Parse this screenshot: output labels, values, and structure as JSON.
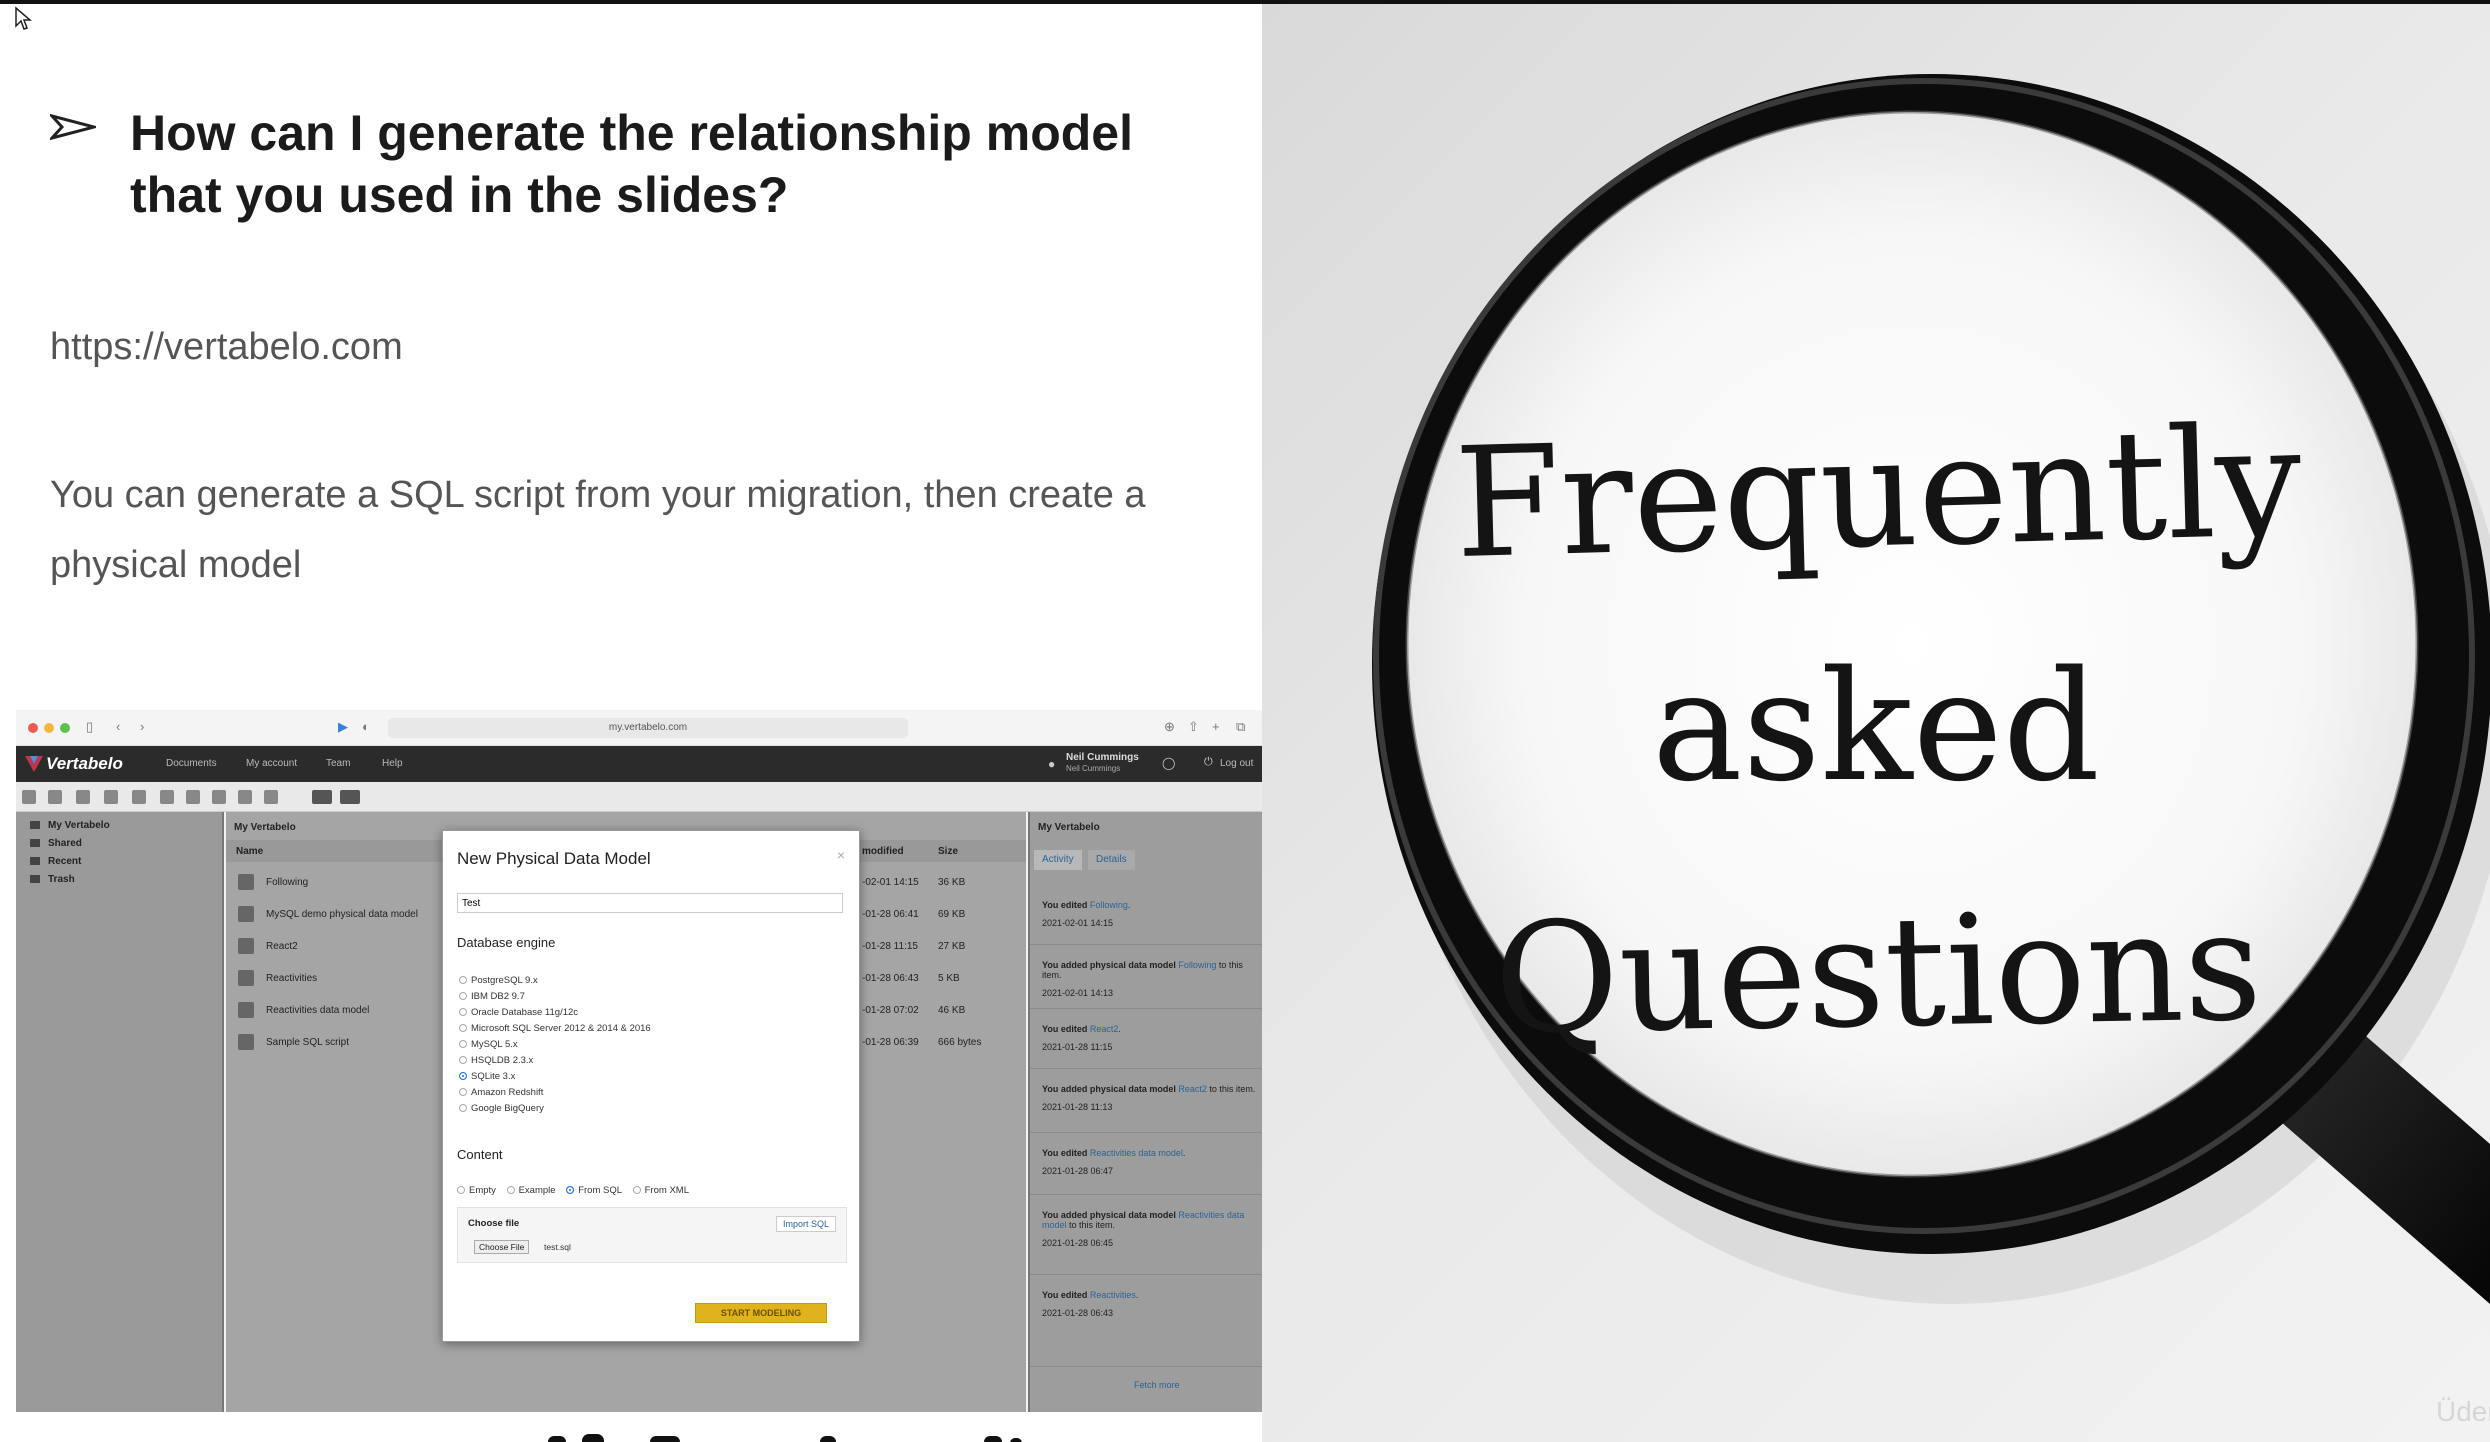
{
  "slide": {
    "question": "How can I generate the relationship model that you used in the slides?",
    "url": "https://vertabelo.com",
    "answer": "You can generate a SQL script from your migration, then create a physical model"
  },
  "screenshot": {
    "address": "my.vertabelo.com",
    "logo": "Vertabelo",
    "nav": [
      "Documents",
      "My account",
      "Team",
      "Help"
    ],
    "user_name": "Neil Cummings",
    "user_sub": "Neil Cummings",
    "logout": "Log out",
    "tree": [
      "My Vertabelo",
      "Shared",
      "Recent",
      "Trash"
    ],
    "files_title": "My Vertabelo",
    "col_name": "Name",
    "col_modified": "modified",
    "col_size": "Size",
    "files": [
      {
        "name": "Following",
        "modified": "-02-01 14:15",
        "size": "36 KB"
      },
      {
        "name": "MySQL demo physical data model",
        "modified": "-01-28 06:41",
        "size": "69 KB"
      },
      {
        "name": "React2",
        "modified": "-01-28 11:15",
        "size": "27 KB"
      },
      {
        "name": "Reactivities",
        "modified": "-01-28 06:43",
        "size": "5 KB"
      },
      {
        "name": "Reactivities data model",
        "modified": "-01-28 07:02",
        "size": "46 KB"
      },
      {
        "name": "Sample SQL script",
        "modified": "-01-28 06:39",
        "size": "666 bytes"
      }
    ],
    "activity_title": "My Vertabelo",
    "activity_tabs": [
      "Activity",
      "Details"
    ],
    "activity": [
      {
        "pre": "You edited ",
        "link": "Following",
        "post": ".",
        "date": "2021-02-01 14:15"
      },
      {
        "pre": "You added physical data model ",
        "link": "Following",
        "post": " to this item.",
        "date": "2021-02-01 14:13"
      },
      {
        "pre": "You edited ",
        "link": "React2",
        "post": ".",
        "date": "2021-01-28 11:15"
      },
      {
        "pre": "You added physical data model ",
        "link": "React2",
        "post": " to this item.",
        "date": "2021-01-28 11:13"
      },
      {
        "pre": "You edited ",
        "link": "Reactivities data model",
        "post": ".",
        "date": "2021-01-28 06:47"
      },
      {
        "pre": "You added physical data model ",
        "link": "Reactivities data model",
        "post": " to this item.",
        "date": "2021-01-28 06:45"
      },
      {
        "pre": "You edited ",
        "link": "Reactivities",
        "post": ".",
        "date": "2021-01-28 06:43"
      }
    ],
    "fetch_more": "Fetch more",
    "modal": {
      "title": "New Physical Data Model",
      "close": "×",
      "name_value": "Test",
      "db_label": "Database engine",
      "engines": [
        "PostgreSQL 9.x",
        "IBM DB2 9.7",
        "Oracle Database 11g/12c",
        "Microsoft SQL Server 2012 & 2014 & 2016",
        "MySQL 5.x",
        "HSQLDB 2.3.x",
        "SQLite 3.x",
        "Amazon Redshift",
        "Google BigQuery"
      ],
      "selected_engine": "SQLite 3.x",
      "content_label": "Content",
      "content_options": [
        "Empty",
        "Example",
        "From SQL",
        "From XML"
      ],
      "selected_content": "From SQL",
      "choose_label": "Choose file",
      "import_label": "Import SQL",
      "choose_btn": "Choose File",
      "chosen_file": "test.sql",
      "start_label": "START MODELING"
    }
  },
  "photo": {
    "words": [
      "Frequently",
      "asked",
      "Questions"
    ],
    "watermark": "Üder"
  }
}
